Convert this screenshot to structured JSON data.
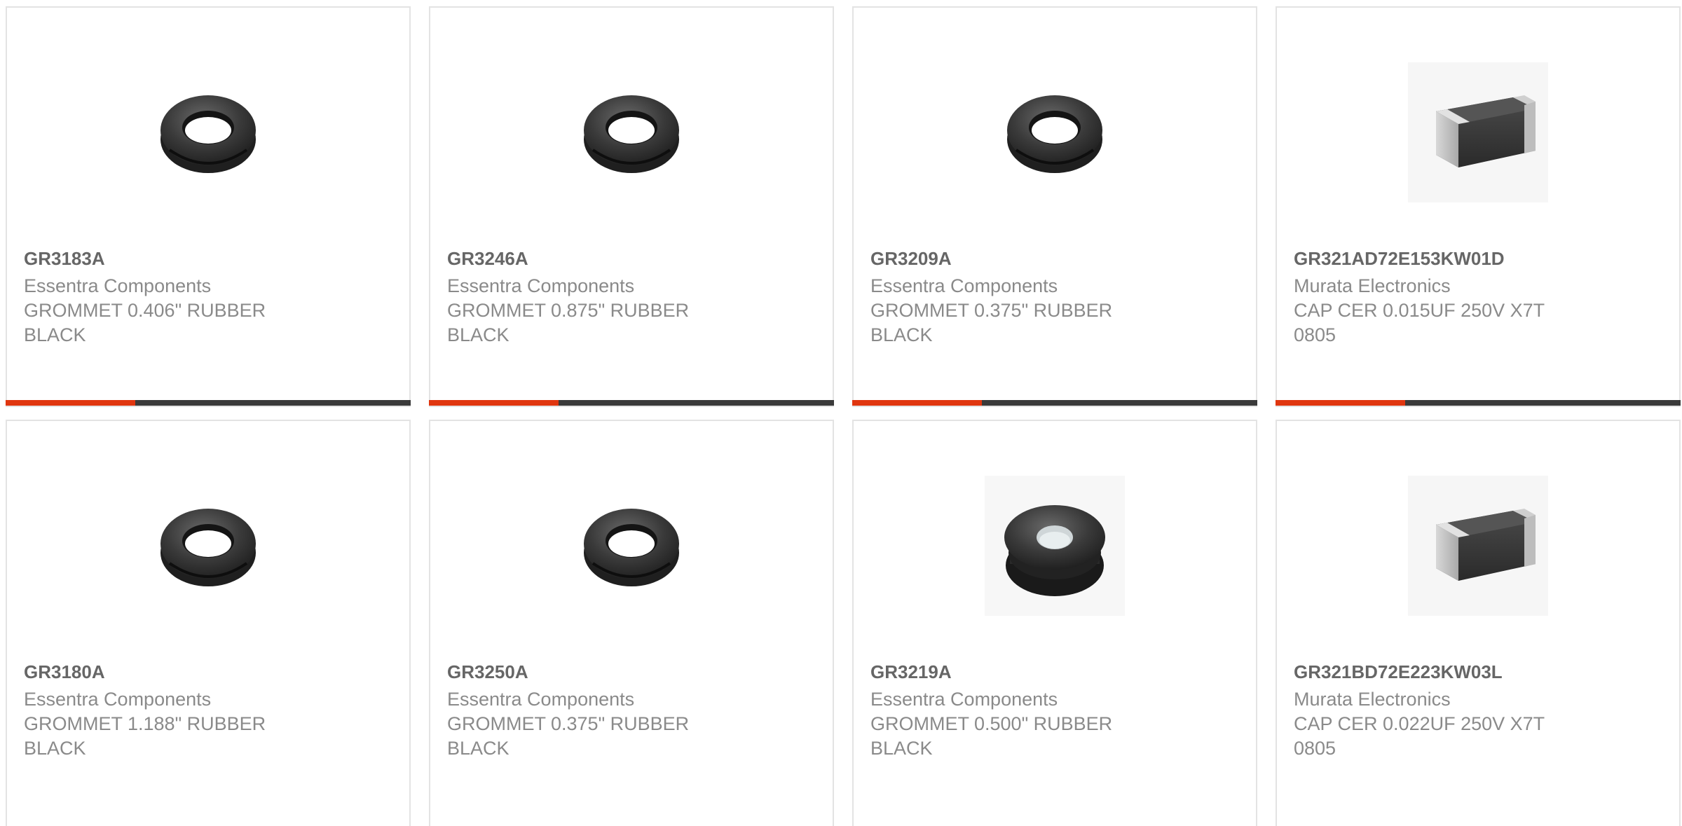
{
  "colors": {
    "card_border": "#e3e3e3",
    "accent": "#e0360f",
    "bar_track": "#3a3a3a",
    "part_number_text": "#666666",
    "secondary_text": "#8a8a8a"
  },
  "products": [
    {
      "part_number": "GR3183A",
      "manufacturer": "Essentra Components",
      "description": "GROMMET 0.406\" RUBBER\nBLACK",
      "image_icon": "rubber-grommet-icon",
      "hover_progress": 0.32
    },
    {
      "part_number": "GR3246A",
      "manufacturer": "Essentra Components",
      "description": "GROMMET 0.875\" RUBBER\nBLACK",
      "image_icon": "rubber-grommet-icon",
      "hover_progress": 0.32
    },
    {
      "part_number": "GR3209A",
      "manufacturer": "Essentra Components",
      "description": "GROMMET 0.375\" RUBBER\nBLACK",
      "image_icon": "rubber-grommet-icon",
      "hover_progress": 0.32
    },
    {
      "part_number": "GR321AD72E153KW01D",
      "manufacturer": "Murata Electronics",
      "description": "CAP CER 0.015UF 250V X7T\n0805",
      "image_icon": "smd-capacitor-icon",
      "hover_progress": 0.32
    },
    {
      "part_number": "GR3180A",
      "manufacturer": "Essentra Components",
      "description": "GROMMET 1.188\" RUBBER\nBLACK",
      "image_icon": "rubber-grommet-icon"
    },
    {
      "part_number": "GR3250A",
      "manufacturer": "Essentra Components",
      "description": "GROMMET 0.375\" RUBBER\nBLACK",
      "image_icon": "rubber-grommet-icon"
    },
    {
      "part_number": "GR3219A",
      "manufacturer": "Essentra Components",
      "description": "GROMMET 0.500\" RUBBER\nBLACK",
      "image_icon": "flat-grommet-icon"
    },
    {
      "part_number": "GR321BD72E223KW03L",
      "manufacturer": "Murata Electronics",
      "description": "CAP CER 0.022UF 250V X7T\n0805",
      "image_icon": "smd-capacitor-icon"
    }
  ]
}
